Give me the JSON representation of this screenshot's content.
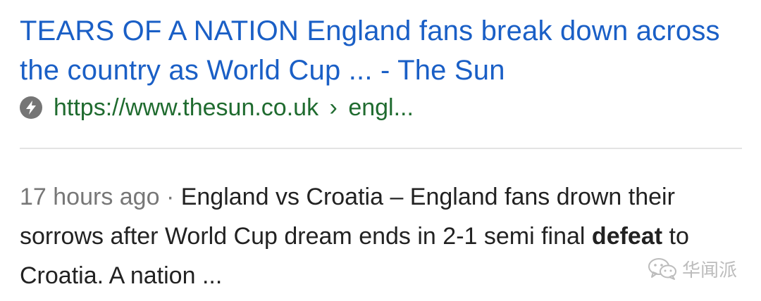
{
  "result": {
    "title": "TEARS OF A NATION England fans break down across the country as World Cup ... - The Sun",
    "url": {
      "domain": "https://www.thesun.co.uk",
      "separator": "›",
      "path": "engl..."
    },
    "amp_icon": "lightning-bolt-icon",
    "snippet": {
      "date": "17 hours ago",
      "date_separator": " · ",
      "text_before_bold": "England vs Croatia – England fans drown their sorrows after World Cup dream ends in 2-1 semi final ",
      "bold": "defeat",
      "text_after_bold": " to Croatia. A nation ..."
    }
  },
  "watermark": {
    "icon": "wechat-icon",
    "text": "华闻派"
  },
  "colors": {
    "title_link": "#1a5fc6",
    "url": "#1f6b2f",
    "date": "#777777",
    "snippet": "#222222",
    "divider": "#e3e3e3",
    "amp_icon_bg": "#757575"
  }
}
